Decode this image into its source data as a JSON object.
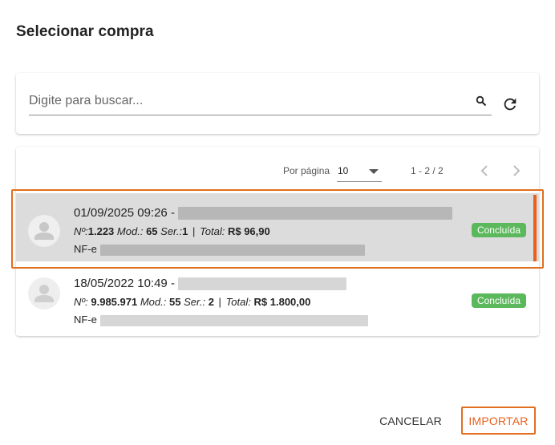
{
  "dialog": {
    "title": "Selecionar compra"
  },
  "search": {
    "placeholder": "Digite para buscar...",
    "value": ""
  },
  "pager": {
    "per_page_label": "Por página",
    "per_page_value": "10",
    "range": "1 - 2 / 2"
  },
  "purchases": [
    {
      "datetime": "01/09/2025 09:26 -",
      "number_label": "Nº:",
      "number": "1.223",
      "model_label": "Mod.:",
      "model": "65",
      "series_label": "Ser.:",
      "series": "1",
      "separator": "|",
      "total_label": "Total:",
      "total": "R$ 96,90",
      "doc_prefix": "NF-e",
      "status": "Concluída",
      "selected": true
    },
    {
      "datetime": "18/05/2022 10:49 -",
      "number_label": "Nº:",
      "number": "9.985.971",
      "model_label": "Mod.:",
      "model": "55",
      "series_label": "Ser.:",
      "series": "2",
      "separator": "|",
      "total_label": "Total:",
      "total": "R$ 1.800,00",
      "doc_prefix": "NF-e",
      "status": "Concluída",
      "selected": false
    }
  ],
  "actions": {
    "cancel_label": "CANCELAR",
    "import_label": "IMPORTAR"
  },
  "colors": {
    "accent": "#e8601c",
    "status_green": "#5cb85c",
    "selected_bg": "#dcdcdc"
  },
  "icons": [
    "search-icon",
    "refresh-icon",
    "chevron-down-icon",
    "chevron-left-icon",
    "chevron-right-icon",
    "person-icon"
  ]
}
